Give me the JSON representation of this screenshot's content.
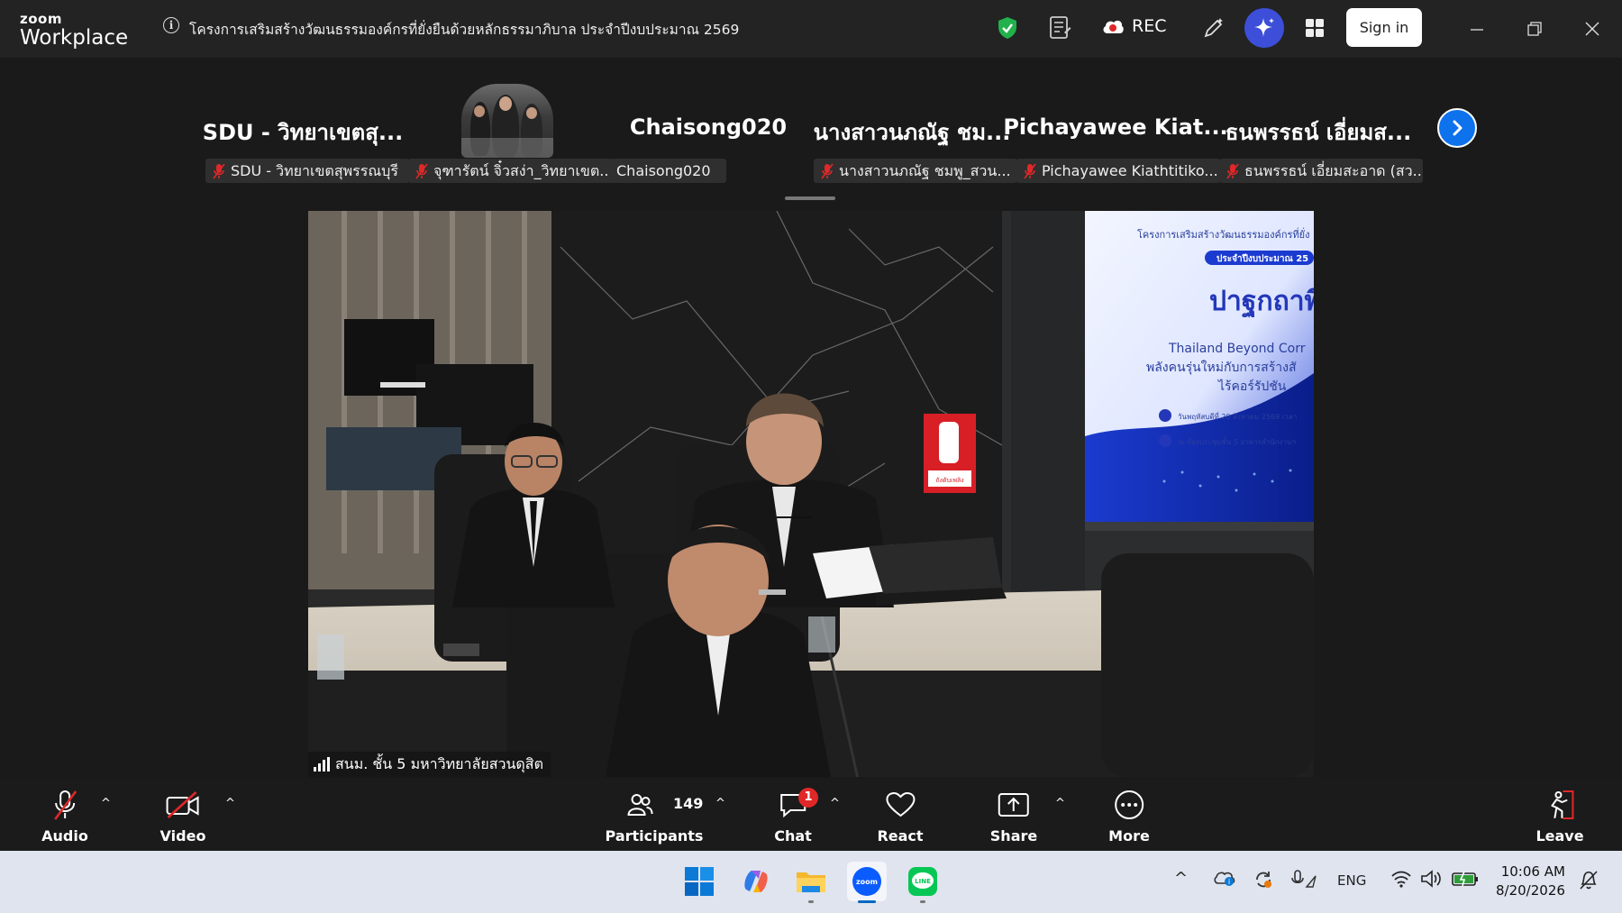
{
  "window": {
    "app_logo_top": "zoom",
    "app_logo_bottom": "Workplace",
    "meeting_title": "โครงการเสริมสร้างวัฒนธรรมองค์กรที่ยั่งยืนด้วยหลักธรรมาภิบาล ประจำปีงบประมาณ 2569",
    "rec_label": "REC",
    "sign_in_label": "Sign in",
    "accent": "#0e72ed"
  },
  "participants_strip": {
    "names": [
      "SDU - วิทยาเขตสุ...",
      "Chaisong020",
      "นางสาวนภณัฐ ชม...",
      "Pichayawee  Kiat...",
      "ธนพรรธน์ เอี่ยมส..."
    ],
    "pills": [
      {
        "label": "SDU - วิทยาเขตสุพรรณบุรี",
        "muted": true
      },
      {
        "label": "จุฑารัตน์ จิ๋วสง่า_วิทยาเขต...",
        "muted": true
      },
      {
        "label": "Chaisong020",
        "muted": false
      },
      {
        "label": "นางสาวนภณัฐ ชมพู_สวน...",
        "muted": true
      },
      {
        "label": "Pichayawee Kiathtitiko...",
        "muted": true
      },
      {
        "label": "ธนพรรธน์ เอี่ยมสะอาด (สว...",
        "muted": true
      }
    ]
  },
  "active_speaker": {
    "label": "สนม. ชั้น 5 มหาวิทยาลัยสวนดุสิต",
    "slide": {
      "header": "โครงการเสริมสร้างวัฒนธรรมองค์กรที่ยั่ง",
      "year_tag": "ประจำปีงบประมาณ 25",
      "title": "ปาฐกถาพิเ",
      "sub_en": "Thailand Beyond Corr",
      "sub_th1": "พลังคนรุ่นใหม่กับการสร้างสั",
      "sub_th2": "ไร้คอร์รัปชัน",
      "date": "วันพฤหัสบดีที่ 20 สิงหาคม 2569 เวลา",
      "place": "ณ ห้องประชุมชั้น 5 อาคารสำนักงานฯ"
    },
    "extinguisher_text": "ถังดับเพลิง"
  },
  "toolbar": {
    "audio": "Audio",
    "video": "Video",
    "participants": "Participants",
    "participants_count": "149",
    "chat": "Chat",
    "chat_badge": "1",
    "react": "React",
    "share": "Share",
    "more": "More",
    "leave": "Leave"
  },
  "taskbar": {
    "apps": [
      "start",
      "copilot",
      "file-explorer",
      "zoom",
      "line"
    ],
    "active_app": "zoom",
    "zoom_app_text": "zoom",
    "line_app_text": "LINE",
    "language": "ENG",
    "time": "10:06 AM",
    "date": "8/20/2026"
  }
}
